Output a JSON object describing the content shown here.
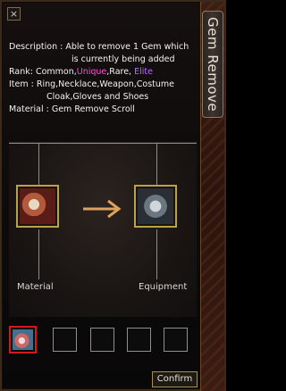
{
  "window": {
    "title": "Gem Remove",
    "close_glyph": "×"
  },
  "description": {
    "line1": "Description : Able to remove 1 Gem which",
    "line2": "is currently being added",
    "rank_prefix": "Rank: Common,",
    "rank_unique": "Unique",
    "rank_mid": ",Rare, ",
    "rank_elite": "Elite",
    "item_line1": "Item : Ring,Necklace,Weapon,Costume",
    "item_line2": "Cloak,Gloves and Shoes",
    "material_line": "Material : Gem Remove Scroll"
  },
  "panel": {
    "material_label": "Material",
    "equipment_label": "Equipment",
    "material_icon": "gem-remove-scroll-icon",
    "equipment_icon": "equipment-icon"
  },
  "gem_slots": {
    "count": 5,
    "selected": 1,
    "selected_icon": "gem-icon"
  },
  "buttons": {
    "confirm": "Confirm"
  },
  "colors": {
    "unique": "#ff49d6",
    "elite": "#b76cff",
    "selected_border": "#d31a1a",
    "slot_border": "#b9a24a"
  }
}
